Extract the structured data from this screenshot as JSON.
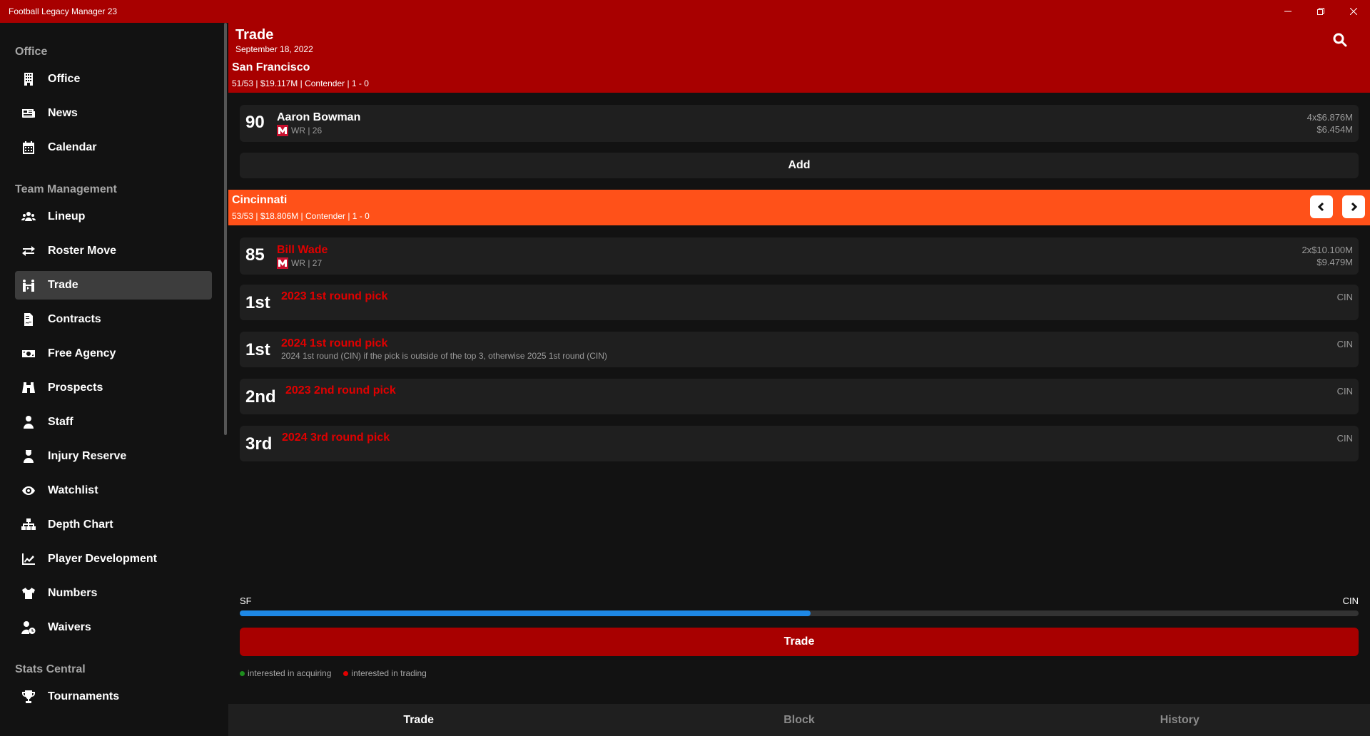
{
  "window": {
    "title": "Football Legacy Manager 23"
  },
  "sidebar": {
    "sections": [
      {
        "title": "Office",
        "items": [
          {
            "label": "Office",
            "icon": "building-icon"
          },
          {
            "label": "News",
            "icon": "newspaper-icon"
          },
          {
            "label": "Calendar",
            "icon": "calendar-icon"
          }
        ]
      },
      {
        "title": "Team Management",
        "items": [
          {
            "label": "Lineup",
            "icon": "users-icon"
          },
          {
            "label": "Roster Move",
            "icon": "swap-icon"
          },
          {
            "label": "Trade",
            "icon": "trade-icon",
            "active": true
          },
          {
            "label": "Contracts",
            "icon": "contract-icon"
          },
          {
            "label": "Free Agency",
            "icon": "money-icon"
          },
          {
            "label": "Prospects",
            "icon": "binoculars-icon"
          },
          {
            "label": "Staff",
            "icon": "user-tie-icon"
          },
          {
            "label": "Injury Reserve",
            "icon": "user-injured-icon"
          },
          {
            "label": "Watchlist",
            "icon": "eye-icon"
          },
          {
            "label": "Depth Chart",
            "icon": "sitemap-icon"
          },
          {
            "label": "Player Development",
            "icon": "chart-line-icon"
          },
          {
            "label": "Numbers",
            "icon": "jersey-icon"
          },
          {
            "label": "Waivers",
            "icon": "user-clock-icon"
          }
        ]
      },
      {
        "title": "Stats Central",
        "items": [
          {
            "label": "Tournaments",
            "icon": "trophy-icon"
          }
        ]
      }
    ]
  },
  "header": {
    "title": "Trade",
    "date": "September 18, 2022",
    "team": "San Francisco",
    "team_info": "51/53 | $19.117M | Contender | 1 - 0"
  },
  "my_side": {
    "players": [
      {
        "ovr": "90",
        "name": "Aaron Bowman",
        "sub": "WR | 26",
        "contract_line1": "4x$6.876M",
        "contract_line2": "$6.454M"
      }
    ],
    "add_label": "Add"
  },
  "partner": {
    "team": "Cincinnati",
    "team_info": "53/53 | $18.806M | Contender | 1 - 0",
    "players": [
      {
        "ovr": "85",
        "name": "Bill Wade",
        "sub": "WR | 27",
        "contract_line1": "2x$10.100M",
        "contract_line2": "$9.479M"
      }
    ],
    "picks": [
      {
        "round": "1st",
        "name": "2023 1st round pick",
        "desc": "",
        "team": "CIN"
      },
      {
        "round": "1st",
        "name": "2024 1st round pick",
        "desc": "2024 1st round (CIN) if the pick is outside of the top 3, otherwise 2025 1st round (CIN)",
        "team": "CIN"
      },
      {
        "round": "2nd",
        "name": "2023 2nd round pick",
        "desc": "",
        "team": "CIN"
      },
      {
        "round": "3rd",
        "name": "2024 3rd round pick",
        "desc": "",
        "team": "CIN"
      }
    ]
  },
  "balance": {
    "left": "SF",
    "right": "CIN",
    "value": 0.51
  },
  "trade_button": "Trade",
  "legend": {
    "acquiring": "interested in acquiring",
    "trading": "interested in trading",
    "acquiring_color": "#1e8e1e",
    "trading_color": "#e00000"
  },
  "tabs": [
    "Trade",
    "Block",
    "History"
  ],
  "colors": {
    "accent": "#a80000",
    "partner": "#ff5119",
    "highlight": "#e00000"
  }
}
